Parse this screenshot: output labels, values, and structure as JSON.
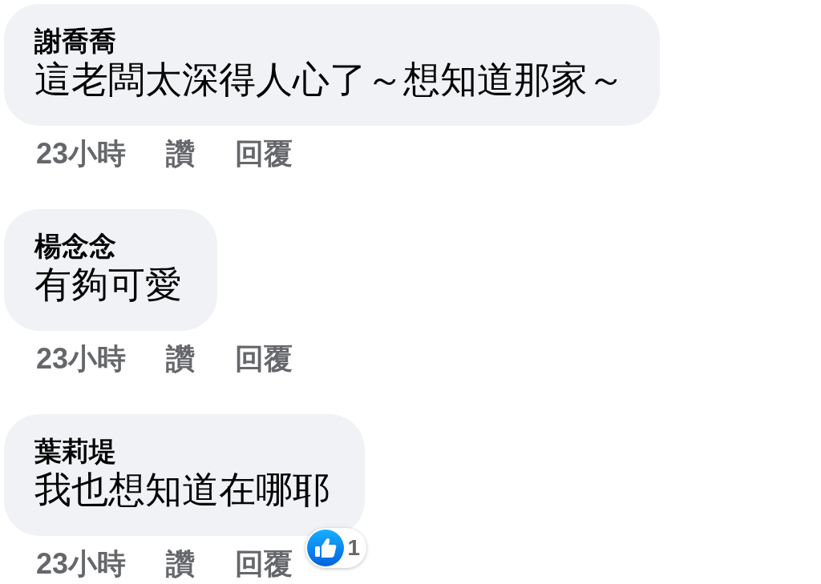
{
  "comments": [
    {
      "author": "謝喬喬",
      "text": "這老闆太深得人心了～想知道那家～",
      "time": "23小時",
      "like": "讚",
      "reply": "回覆"
    },
    {
      "author": "楊念念",
      "text": "有夠可愛",
      "time": "23小時",
      "like": "讚",
      "reply": "回覆"
    },
    {
      "author": "葉莉堤",
      "text": "我也想知道在哪耶",
      "time": "23小時",
      "like": "讚",
      "reply": "回覆",
      "reactions": {
        "count": "1"
      }
    }
  ]
}
